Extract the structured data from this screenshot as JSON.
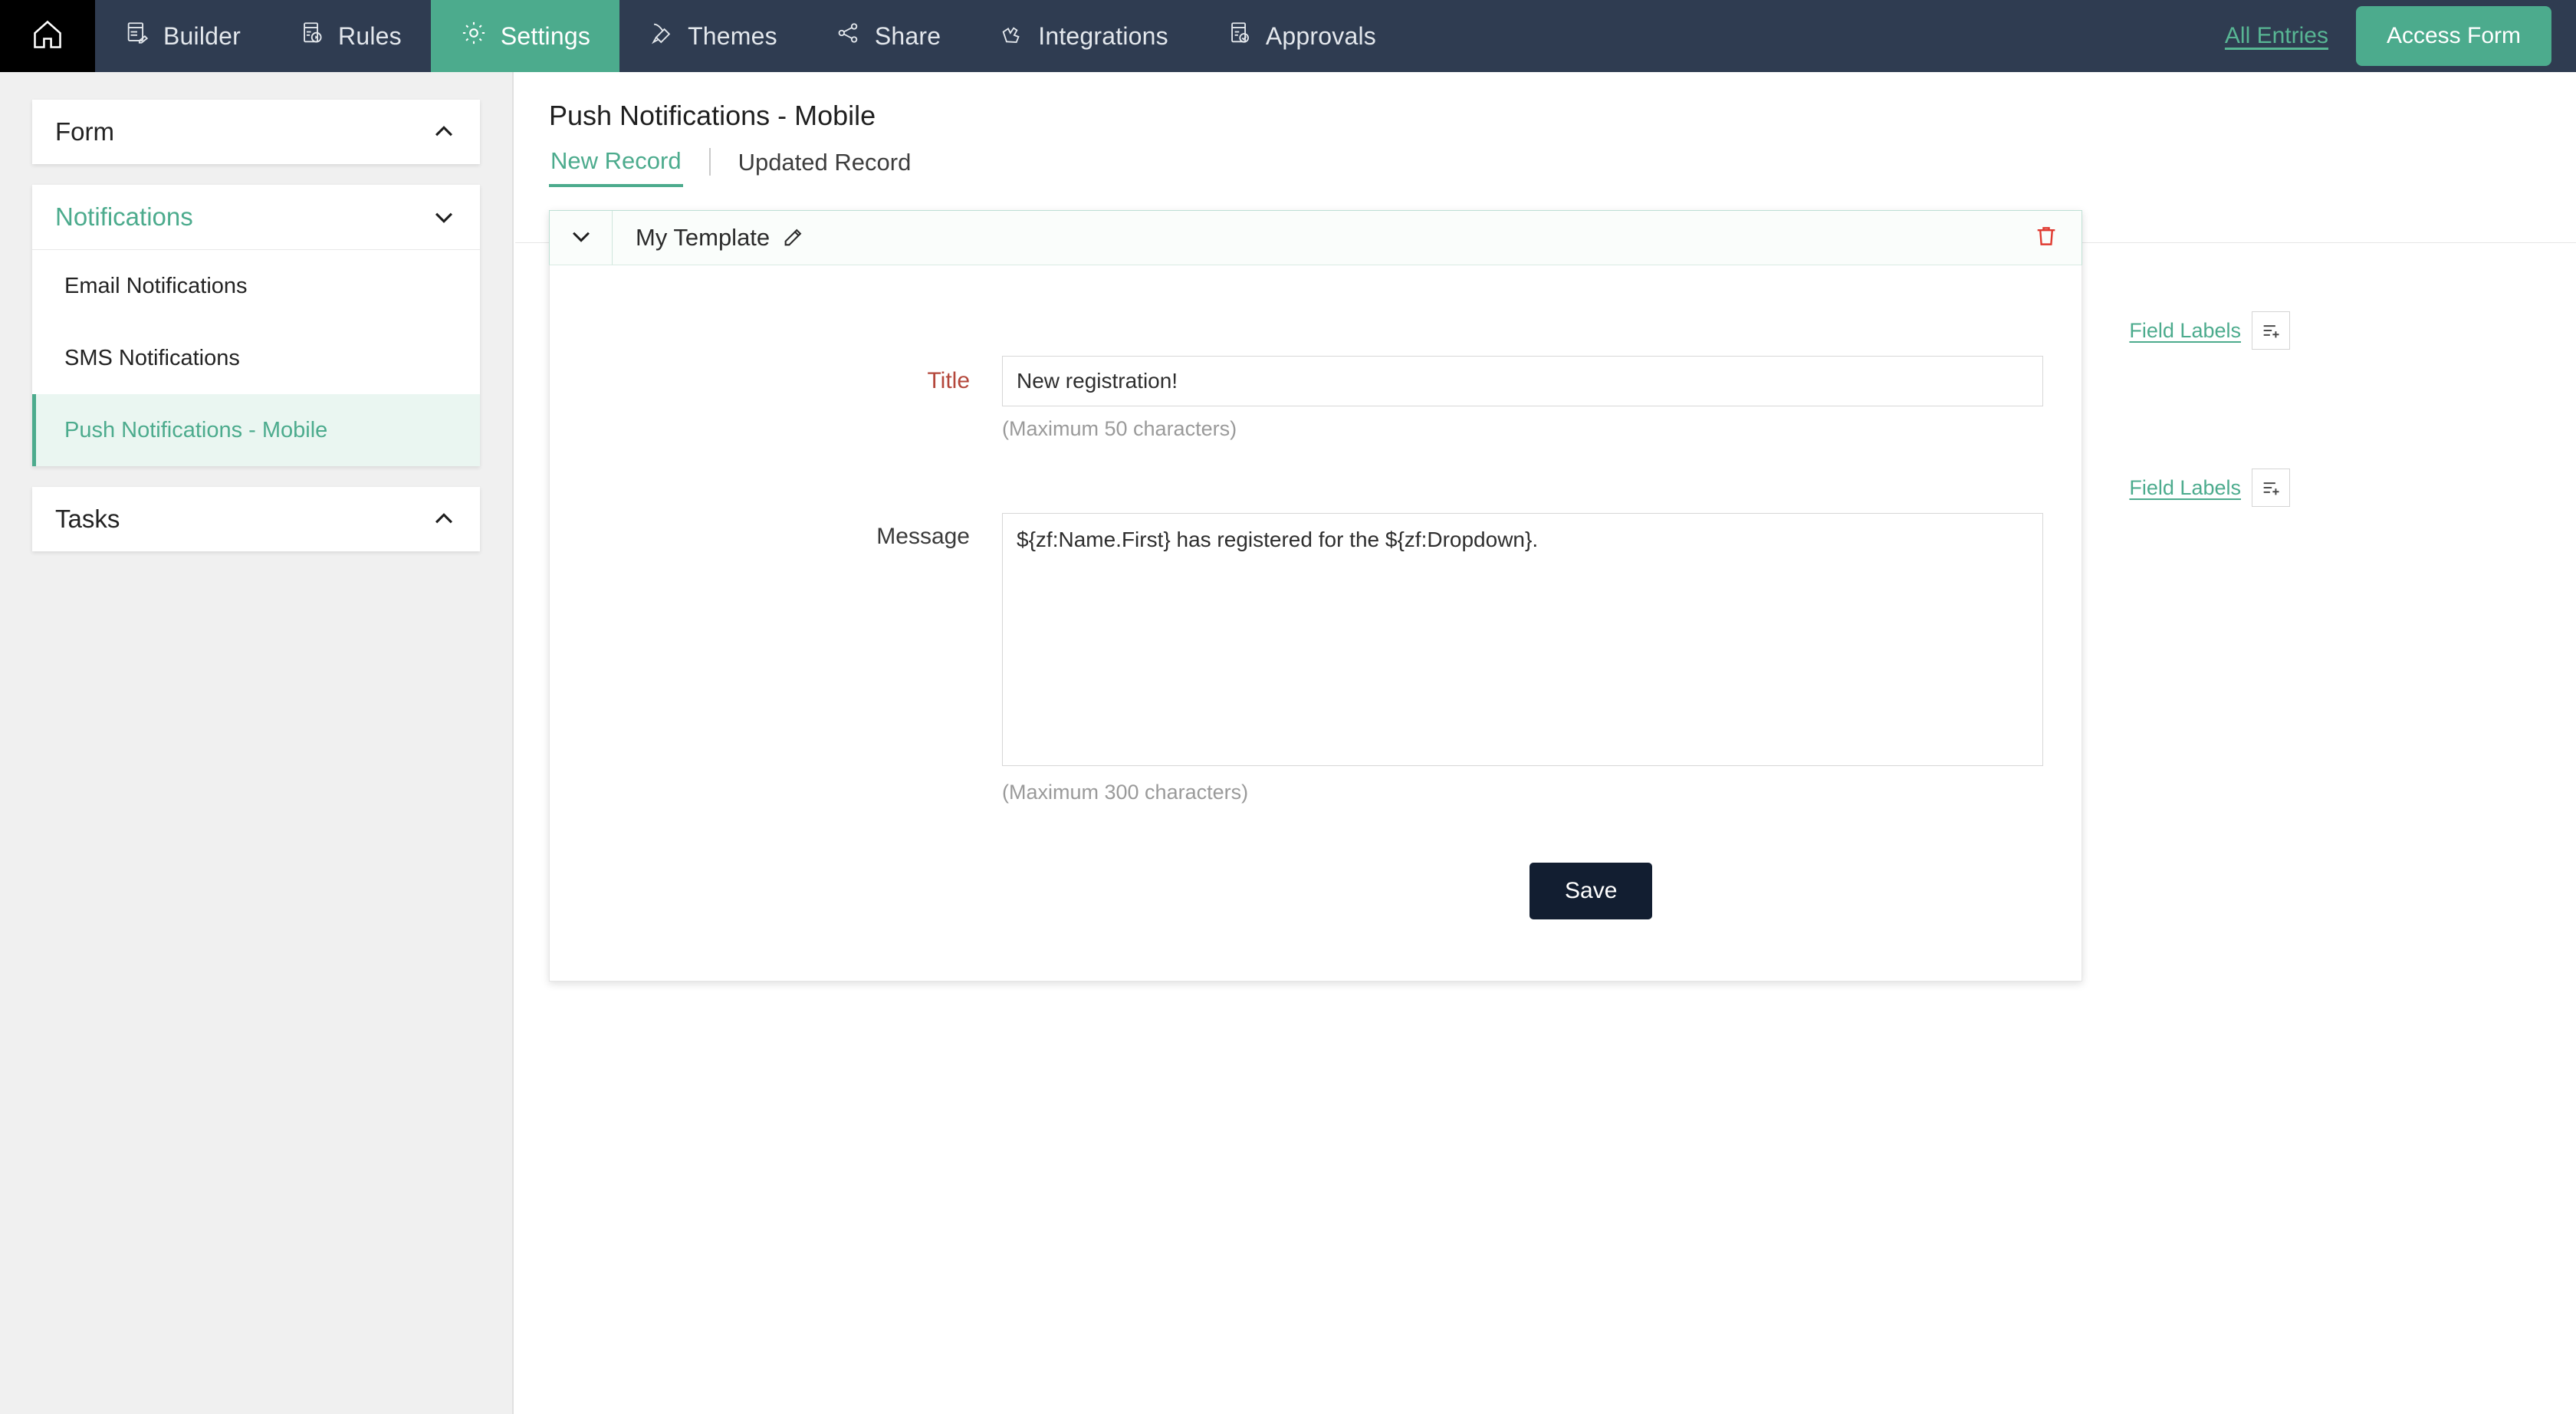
{
  "topnav": {
    "home_icon": "home-icon",
    "items": [
      {
        "label": "Builder",
        "icon": "builder-icon",
        "active": false
      },
      {
        "label": "Rules",
        "icon": "rules-icon",
        "active": false
      },
      {
        "label": "Settings",
        "icon": "gear-icon",
        "active": true
      },
      {
        "label": "Themes",
        "icon": "themes-brush-icon",
        "active": false
      },
      {
        "label": "Share",
        "icon": "share-nodes-icon",
        "active": false
      },
      {
        "label": "Integrations",
        "icon": "integrations-icon",
        "active": false
      },
      {
        "label": "Approvals",
        "icon": "approvals-icon",
        "active": false
      }
    ],
    "all_entries_label": "All Entries",
    "access_form_label": "Access Form",
    "bg_color": "#2f3c51",
    "accent_color": "#4cab8d"
  },
  "sidebar": {
    "sections": [
      {
        "label": "Form",
        "expanded": true,
        "chevron": "chevron-up-icon",
        "active": false
      },
      {
        "label": "Notifications",
        "expanded": false,
        "chevron": "chevron-down-icon",
        "active": true
      },
      {
        "label": "Tasks",
        "expanded": true,
        "chevron": "chevron-up-icon",
        "active": false
      }
    ],
    "notification_items": [
      {
        "label": "Email Notifications",
        "active": false
      },
      {
        "label": "SMS Notifications",
        "active": false
      },
      {
        "label": "Push Notifications - Mobile",
        "active": true
      }
    ]
  },
  "main": {
    "page_title": "Push Notifications - Mobile",
    "tabs": [
      {
        "label": "New Record",
        "active": true
      },
      {
        "label": "Updated Record",
        "active": false
      }
    ],
    "tab_separator": "|"
  },
  "template": {
    "collapse_icon": "chevron-down-icon",
    "name": "My Template",
    "edit_icon": "pencil-icon",
    "delete_icon": "trash-icon",
    "delete_color": "#e03b31",
    "fields": [
      {
        "label": "Title",
        "required": true,
        "value": "New registration!",
        "placeholder": "",
        "hint": "(Maximum 50 characters)",
        "field_labels_link": "Field Labels",
        "field_labels_icon": "insert-field-icon"
      },
      {
        "label": "Message",
        "required": false,
        "value": "${zf:Name.First} has registered for the ${zf:Dropdown}.",
        "placeholder": "",
        "hint": "(Maximum 300 characters)",
        "field_labels_link": "Field Labels",
        "field_labels_icon": "insert-field-icon"
      }
    ],
    "save_label": "Save"
  }
}
